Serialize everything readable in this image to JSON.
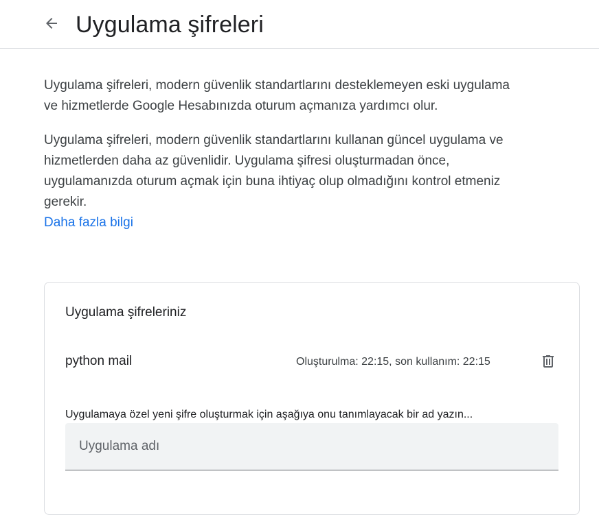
{
  "header": {
    "back_icon": "arrow-left-icon",
    "title": "Uygulama şifreleri"
  },
  "intro": {
    "paragraph_1": "Uygulama şifreleri, modern güvenlik standartlarını desteklemeyen eski uygulama ve hizmetlerde Google Hesabınızda oturum açmanıza yardımcı olur.",
    "paragraph_2": "Uygulama şifreleri, modern güvenlik standartlarını kullanan güncel uygulama ve hizmetlerden daha az güvenlidir. Uygulama şifresi oluşturmadan önce, uygulamanızda oturum açmak için buna ihtiyaç olup olmadığını kontrol etmeniz gerekir.",
    "learn_more": "Daha fazla bilgi"
  },
  "passwords_card": {
    "title": "Uygulama şifreleriniz",
    "items": [
      {
        "name": "python mail",
        "meta": "Oluşturulma: 22:15, son kullanım: 22:15",
        "delete_icon": "trash-icon"
      }
    ],
    "helper_text": "Uygulamaya özel yeni şifre oluşturmak için aşağıya onu tanımlayacak bir ad yazın...",
    "input": {
      "placeholder": "Uygulama adı",
      "value": ""
    }
  },
  "colors": {
    "link": "#1a73e8",
    "text_primary": "#202124",
    "text_secondary": "#3c4043",
    "border": "#dadce0",
    "input_bg": "#f1f3f4"
  }
}
